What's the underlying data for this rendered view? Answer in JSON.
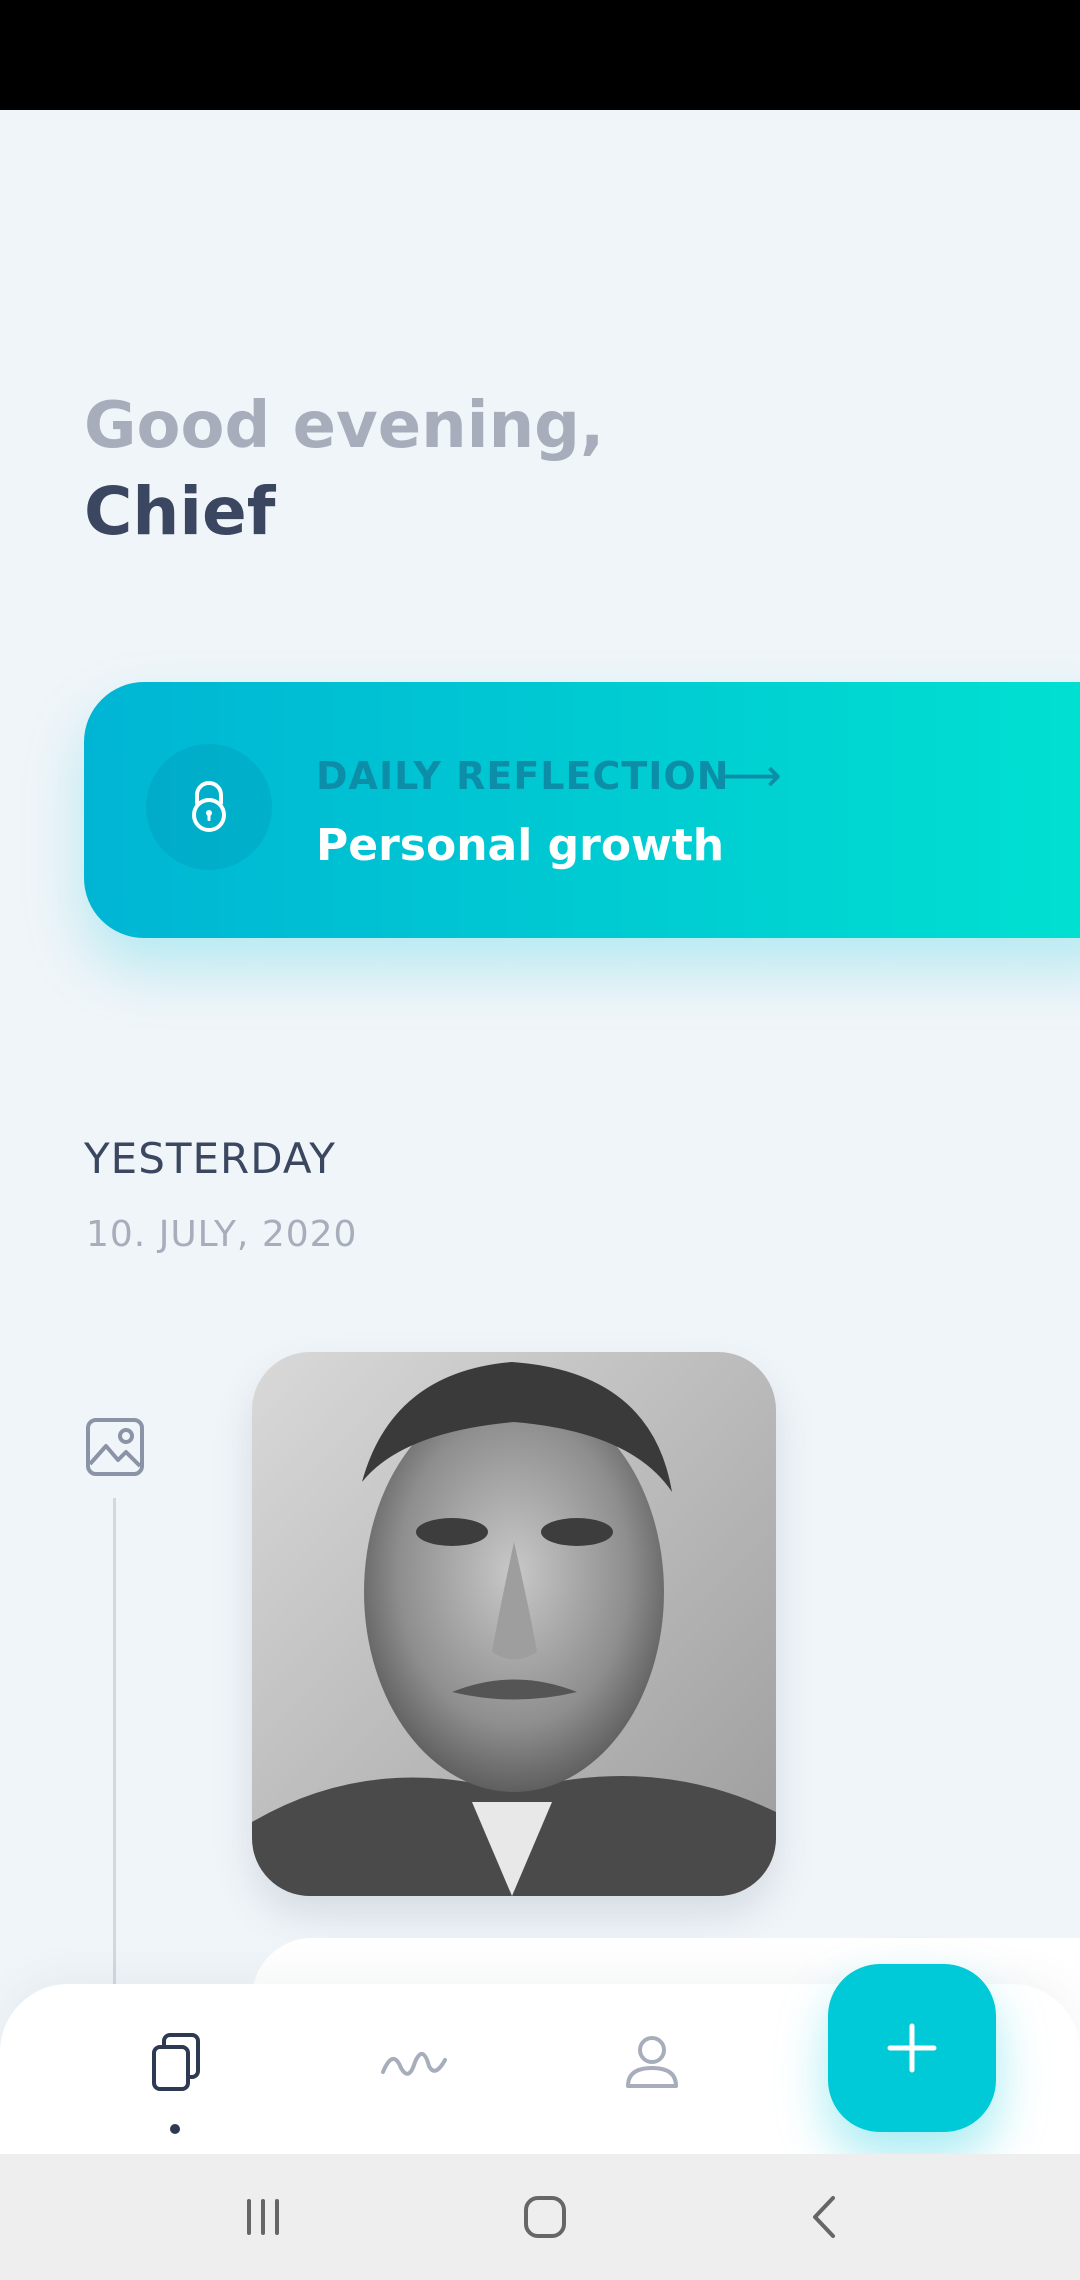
{
  "greeting": {
    "line1": "Good evening,",
    "line2": "Chief"
  },
  "reflection": {
    "label": "DAILY REFLECTION",
    "arrow": "⟶",
    "title": "Personal growth",
    "icon": "lock-icon"
  },
  "section": {
    "day": "YESTERDAY",
    "date": "10. JULY, 2020"
  },
  "timeline": {
    "entry_icon": "image-icon",
    "photo_icon": "portrait-photo"
  },
  "bottom_nav": {
    "items": [
      "journal-cards-icon",
      "mood-wave-icon",
      "profile-icon"
    ],
    "active_index": 0,
    "fab_icon": "plus-icon"
  },
  "colors": {
    "background": "#f0f5f9",
    "accent": "#00c9d8",
    "text_dark": "#3b4760",
    "text_muted": "#a7adbb"
  }
}
